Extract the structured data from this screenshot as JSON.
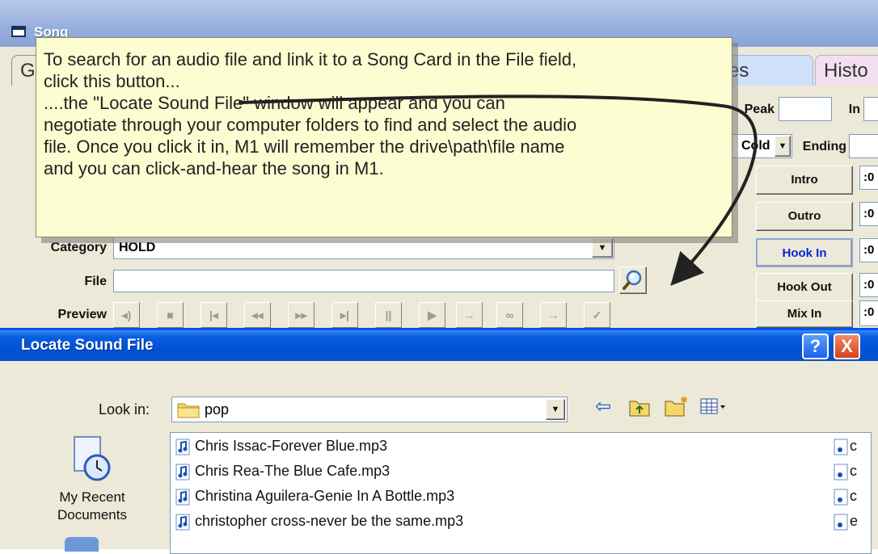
{
  "song_window": {
    "title": "Song",
    "tabs": [
      "G",
      "es",
      "Histo"
    ],
    "peak_label": "Peak",
    "in_label": "In",
    "cold_value": "Cold",
    "ending_label": "Ending",
    "category_label": "Category",
    "category_value": "HOLD",
    "file_label": "File",
    "file_value": "",
    "preview_label": "Preview",
    "preview_buttons": [
      "audio",
      "stop",
      "go-start",
      "rewind",
      "fast-forward",
      "go-end",
      "pause",
      "play",
      "next",
      "loop",
      "skip",
      "check"
    ],
    "side_buttons": [
      {
        "label": "Intro",
        "time": ":0",
        "color": "#111111"
      },
      {
        "label": "Outro",
        "time": ":0",
        "color": "#111111"
      },
      {
        "label": "Hook In",
        "time": ":0",
        "color": "#0a23d8"
      },
      {
        "label": "Hook Out",
        "time": ":0",
        "color": "#111111"
      },
      {
        "label": "Mix In",
        "time": ":0",
        "color": "#111111"
      }
    ]
  },
  "tooltip": {
    "lines": [
      "To search for an audio file and link it to a Song Card in the File field,",
      "click this button...",
      "....the \"Locate Sound File\" window will appear and you can",
      "negotiate through your computer folders to find and select the audio",
      "file.  Once you click it in, M1 will remember the drive\\path\\file name",
      "and you can click-and-hear the song in M1."
    ]
  },
  "locate_dialog": {
    "title": "Locate Sound File",
    "help_label": "?",
    "close_label": "X",
    "look_in_label": "Look in:",
    "look_in_value": "pop",
    "places": [
      {
        "label_line1": "My Recent",
        "label_line2": "Documents"
      }
    ],
    "files": [
      "Chris Issac-Forever Blue.mp3",
      "Chris Rea-The Blue Cafe.mp3",
      "Christina Aguilera-Genie In A Bottle.mp3",
      "christopher cross-never be the same.mp3"
    ],
    "right_column_letters": [
      "c",
      "c",
      "c",
      "e"
    ]
  },
  "colors": {
    "tooltip_bg": "#FDFDD2",
    "dialog_title_blue": "#0052d6",
    "close_red": "#e0461e"
  }
}
